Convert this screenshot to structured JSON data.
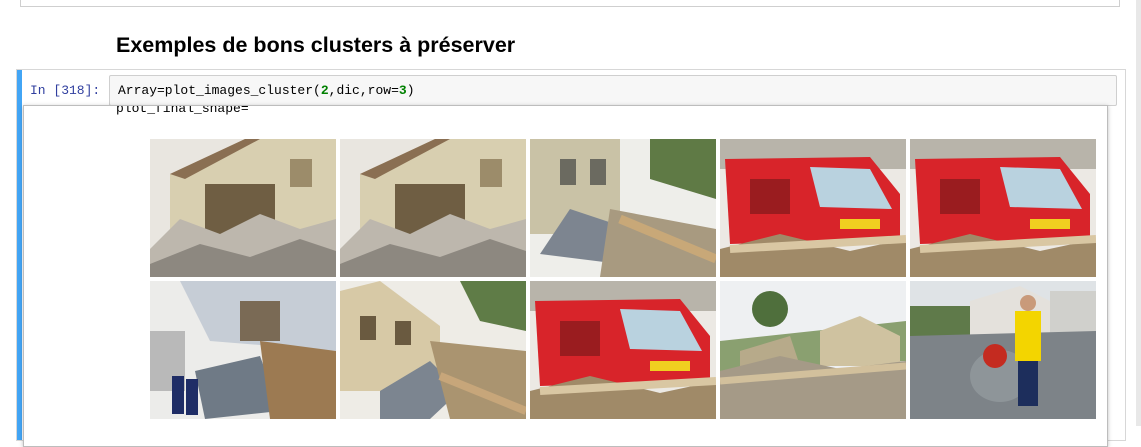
{
  "section": {
    "heading": "Exemples de bons clusters à préserver"
  },
  "cell": {
    "prompt": "In [318]:",
    "code": {
      "prefix": "Array=plot_images_cluster(",
      "n1": "2",
      "mid": ",dic,row=",
      "n2": "3",
      "suffix": ")"
    },
    "stdout": "plot_final_shape="
  },
  "images": [
    {
      "name": "collapsed-house-photo",
      "scene": "collapsed-house"
    },
    {
      "name": "collapsed-house-photo-duplicate",
      "scene": "collapsed-house"
    },
    {
      "name": "wrecked-car-street-photo",
      "scene": "car-debris"
    },
    {
      "name": "red-fire-truck-debris-photo",
      "scene": "fire-truck"
    },
    {
      "name": "red-fire-truck-debris-photo-2",
      "scene": "fire-truck"
    },
    {
      "name": "house-crushed-car-photo",
      "scene": "house-car"
    },
    {
      "name": "damaged-house-debris-photo",
      "scene": "house-debris"
    },
    {
      "name": "red-fire-truck-logs-photo",
      "scene": "fire-truck"
    },
    {
      "name": "village-debris-pile-photo",
      "scene": "village-debris"
    },
    {
      "name": "rescue-worker-flooded-street-photo",
      "scene": "rescue-worker"
    }
  ]
}
